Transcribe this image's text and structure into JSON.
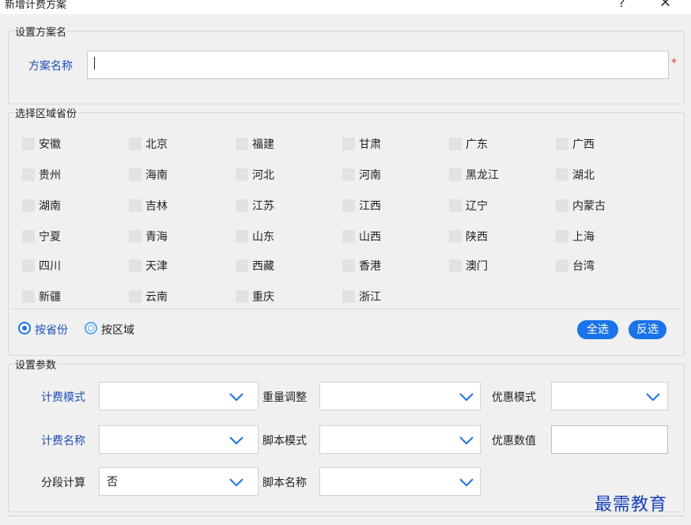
{
  "window": {
    "title": "新增计费方案",
    "help": "?",
    "close": "✕"
  },
  "scheme_group": {
    "legend": "设置方案名",
    "name_label": "方案名称",
    "name_value": "",
    "required_mark": "*"
  },
  "region_group": {
    "legend": "选择区域省份",
    "provinces": [
      "安徽",
      "北京",
      "福建",
      "甘肃",
      "广东",
      "广西",
      "贵州",
      "海南",
      "河北",
      "河南",
      "黑龙江",
      "湖北",
      "湖南",
      "吉林",
      "江苏",
      "江西",
      "辽宁",
      "内蒙古",
      "宁夏",
      "青海",
      "山东",
      "山西",
      "陕西",
      "上海",
      "四川",
      "天津",
      "西藏",
      "香港",
      "澳门",
      "台湾",
      "新疆",
      "云南",
      "重庆",
      "浙江"
    ],
    "radio_by_province": "按省份",
    "radio_by_region": "按区域",
    "select_all": "全选",
    "invert": "反选"
  },
  "params_group": {
    "legend": "设置参数",
    "billing_mode": {
      "label": "计费模式",
      "value": ""
    },
    "billing_name": {
      "label": "计费名称",
      "value": ""
    },
    "segment_calc": {
      "label": "分段计算",
      "value": "否"
    },
    "weight_adjust": {
      "label": "重量调整",
      "value": ""
    },
    "script_mode": {
      "label": "脚本模式",
      "value": ""
    },
    "script_name": {
      "label": "脚本名称",
      "value": ""
    },
    "discount_mode": {
      "label": "优惠模式",
      "value": ""
    },
    "discount_value": {
      "label": "优惠数值",
      "value": ""
    }
  },
  "watermark": "最需教育",
  "colors": {
    "accent": "#1a73e8",
    "label_blue": "#1f4fb4",
    "required": "#e03030"
  },
  "icons": {
    "dropdown": "chevron-down-icon",
    "checkbox": "checkbox-unchecked"
  }
}
